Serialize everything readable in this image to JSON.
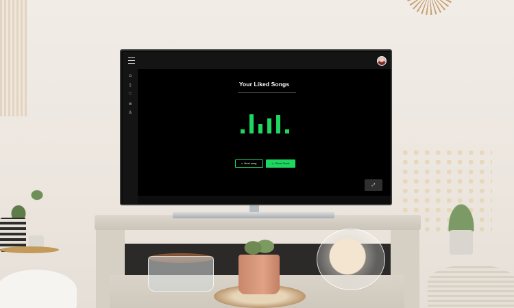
{
  "app": {
    "title": "Your Liked Songs",
    "accent_color": "#1ed760"
  },
  "topbar": {
    "menu_icon": "hamburger-menu-icon",
    "avatar": "user-avatar"
  },
  "sidebar": {
    "items": [
      {
        "name": "home",
        "icon": "home-icon",
        "glyph": "⌂"
      },
      {
        "name": "location",
        "icon": "location-pin-icon",
        "glyph": "◊"
      },
      {
        "name": "favorites",
        "icon": "heart-icon",
        "glyph": "♡"
      },
      {
        "name": "queue",
        "icon": "list-icon",
        "glyph": "≡"
      },
      {
        "name": "profile",
        "icon": "user-icon",
        "glyph": "♙"
      }
    ]
  },
  "visualizer": {
    "levels": [
      0.2,
      1.0,
      0.5,
      0.8,
      0.95,
      0.2
    ]
  },
  "controls": {
    "next_icon": "▸",
    "next_label": "Next song",
    "show_icon": "◎",
    "show_label": "Show Track",
    "fab_icon": "expand-icon",
    "fab_glyph": "⤢"
  }
}
